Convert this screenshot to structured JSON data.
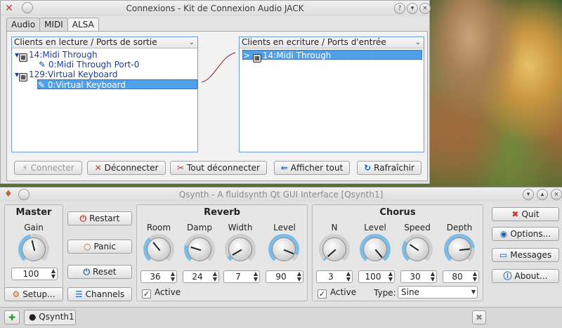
{
  "connexions": {
    "title": "Connexions - Kit de Connexion Audio JACK",
    "tabs": [
      "Audio",
      "MIDI",
      "ALSA"
    ],
    "left_header": "Clients en lecture / Ports de sortie",
    "right_header": "Clients en ecriture / Ports d'entrée",
    "left_tree": [
      {
        "label": "14:Midi Through"
      },
      {
        "label": "0:Midi Through Port-0"
      },
      {
        "label": "129:Virtual Keyboard"
      },
      {
        "label": "0:Virtual Keyboard"
      }
    ],
    "right_tree": [
      {
        "label": "14:Midi Through"
      }
    ],
    "buttons": {
      "connect": "Connecter",
      "disconnect": "Déconnecter",
      "disconnect_all": "Tout déconnecter",
      "show_all": "Afficher tout",
      "refresh": "Rafraîchir"
    }
  },
  "qsynth": {
    "title": "Qsynth - A fluidsynth Qt GUI Interface [Qsynth1]",
    "master": {
      "title": "Master",
      "gain_label": "Gain",
      "gain_value": "100",
      "gain_level": 0.45
    },
    "buttons": {
      "restart": "Restart",
      "panic": "Panic",
      "reset": "Reset",
      "setup": "Setup...",
      "channels": "Channels",
      "quit": "Quit",
      "options": "Options...",
      "messages": "Messages",
      "about": "About..."
    },
    "reverb": {
      "title": "Reverb",
      "room_label": "Room",
      "room_value": "36",
      "room_level": 0.36,
      "damp_label": "Damp",
      "damp_value": "24",
      "damp_level": 0.24,
      "width_label": "Width",
      "width_value": "7",
      "width_level": 0.07,
      "level_label": "Level",
      "level_value": "90",
      "level_level": 0.9,
      "active_label": "Active"
    },
    "chorus": {
      "title": "Chorus",
      "n_label": "N",
      "n_value": "3",
      "n_level": 0.03,
      "level_label": "Level",
      "level_value": "100",
      "level_level": 1.0,
      "speed_label": "Speed",
      "speed_value": "30",
      "speed_level": 0.3,
      "depth_label": "Depth",
      "depth_value": "80",
      "depth_level": 0.8,
      "active_label": "Active",
      "type_label": "Type:",
      "type_value": "Sine"
    },
    "tab_label": "Qsynth1"
  }
}
